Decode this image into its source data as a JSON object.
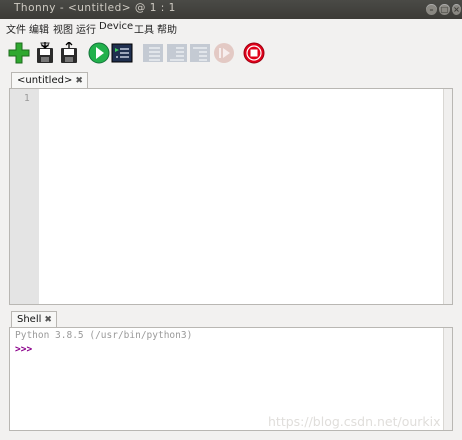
{
  "window": {
    "title": "Thonny - <untitled> @ 1 : 1"
  },
  "menu": [
    "文件",
    "编辑",
    "视图",
    "运行",
    "Device",
    "工具",
    "帮助"
  ],
  "toolbar": {
    "buttons": [
      {
        "name": "new-file",
        "icon": "plus-icon",
        "enabled": true
      },
      {
        "name": "open-file",
        "icon": "folder-disk-icon",
        "enabled": true
      },
      {
        "name": "save-file",
        "icon": "save-disk-icon",
        "enabled": true
      },
      {
        "name": "run",
        "icon": "play-icon",
        "enabled": true
      },
      {
        "name": "debug",
        "icon": "debug-icon",
        "enabled": true
      },
      {
        "name": "step-over",
        "icon": "step-over-icon",
        "enabled": false
      },
      {
        "name": "step-into",
        "icon": "step-into-icon",
        "enabled": false
      },
      {
        "name": "step-out",
        "icon": "step-out-icon",
        "enabled": false
      },
      {
        "name": "resume",
        "icon": "resume-icon",
        "enabled": false
      },
      {
        "name": "stop",
        "icon": "stop-icon",
        "enabled": true
      }
    ]
  },
  "editor": {
    "tab_label": "<untitled>",
    "close_glyph": "✖",
    "line_number": "1"
  },
  "shell": {
    "tab_label": "Shell",
    "close_glyph": "✖",
    "banner": "Python 3.8.5 (/usr/bin/python3)",
    "prompt": ">>>"
  },
  "watermark": "https://blog.csdn.net/ourkix",
  "colors": {
    "prompt": "#8b008b",
    "banner": "#9a9a9a",
    "run": "#22b14c",
    "stop": "#e0001a"
  }
}
